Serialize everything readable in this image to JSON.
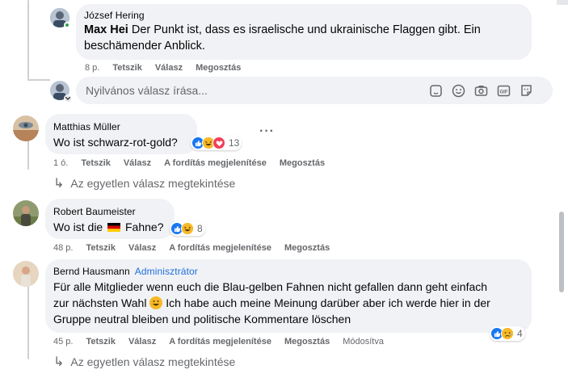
{
  "comments": [
    {
      "author": "József Hering",
      "mention": "Max Hei",
      "text_line1": " Der Punkt ist, dass es israelische und ukrainische Flaggen gibt. Ein",
      "text_line2": "beschämender Anblick.",
      "time": "8 p.",
      "actions": [
        "Tetszik",
        "Válasz",
        "Megosztás"
      ]
    },
    {
      "author": "Matthias Müller",
      "text": "Wo ist schwarz-rot-gold?",
      "reaction_count": "13",
      "time": "1 ó.",
      "actions": [
        "Tetszik",
        "Válasz",
        "A fordítás megjelenítése",
        "Megosztás"
      ],
      "view_replies": "Az egyetlen válasz megtekintése"
    },
    {
      "author": "Robert Baumeister",
      "text_before_flag": "Wo ist die ",
      "text_after_flag": " Fahne?",
      "reaction_count": "8",
      "time": "48 p.",
      "actions": [
        "Tetszik",
        "Válasz",
        "A fordítás megjelenítése",
        "Megosztás"
      ]
    },
    {
      "author": "Bernd Hausmann",
      "badge": "Adminisztrátor",
      "text_line1": "Für alle Mitglieder wenn euch die Blau-gelben Fahnen nicht gefallen dann geht einfach",
      "text_line2a": "zur nächsten Wahl ",
      "text_line2b": " Ich habe auch meine Meinung darüber aber ich werde hier in der",
      "text_line3": "Gruppe neutral bleiben und politische Kommentare löschen",
      "reaction_count": "4",
      "time": "45 p.",
      "actions": [
        "Tetszik",
        "Válasz",
        "A fordítás megjelenítése",
        "Megosztás",
        "Módosítva"
      ],
      "view_replies": "Az egyetlen válasz megtekintése"
    }
  ],
  "reply_box": {
    "placeholder": "Nyilvános válasz írása..."
  },
  "reply_box_icons": [
    "sticker-icon",
    "emoji-icon",
    "camera-icon",
    "gif-icon",
    "sticker-face-icon"
  ],
  "colors": {
    "bubble": "#f0f2f5",
    "meta_text": "#65676b",
    "like": "#1877f2",
    "love": "#f33e58",
    "haha": "#f7b928",
    "admin": "#216fdb"
  }
}
